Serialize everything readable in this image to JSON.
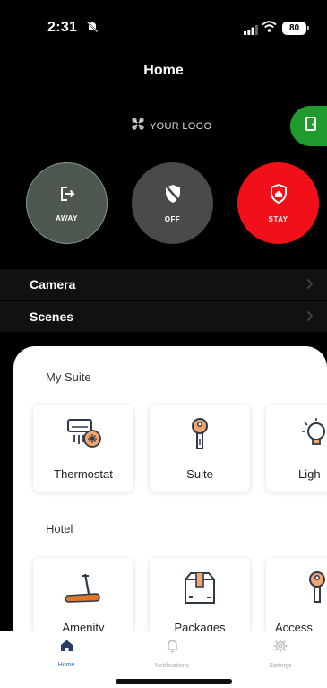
{
  "status_bar": {
    "time": "2:31",
    "battery": "80"
  },
  "header": {
    "title": "Home",
    "logo_text": "YOUR LOGO"
  },
  "modes": [
    {
      "label": "AWAY",
      "icon": "exit-icon"
    },
    {
      "label": "OFF",
      "icon": "shield-off-icon"
    },
    {
      "label": "STAY",
      "icon": "shield-home-icon"
    }
  ],
  "rows": {
    "camera": "Camera",
    "scenes": "Scenes"
  },
  "my_suite": {
    "title": "My Suite",
    "tiles": [
      {
        "label": "Thermostat",
        "icon": "thermostat-icon"
      },
      {
        "label": "Suite",
        "icon": "key-icon"
      },
      {
        "label": "Ligh",
        "icon": "bulb-icon"
      }
    ]
  },
  "hotel": {
    "title": "Hotel",
    "tiles": [
      {
        "label": "Amenity",
        "icon": "treadmill-icon"
      },
      {
        "label": "Packages",
        "icon": "package-icon"
      },
      {
        "label": "Access",
        "icon": "key-icon"
      }
    ]
  },
  "tabbar": {
    "home": "Home",
    "notifications": "Notifications",
    "settings": "Settings"
  },
  "colors": {
    "stay": "#f10f1a",
    "door": "#1f9a2c",
    "tab_active": "#2e6ab8",
    "icon_orange": "#e0762a"
  }
}
